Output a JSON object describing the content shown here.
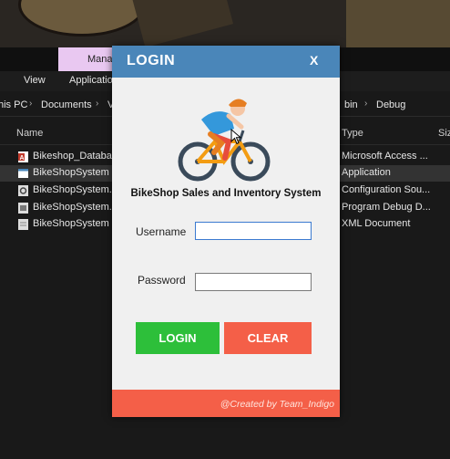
{
  "explorer": {
    "ribbon": {
      "manage_tab": "Mana"
    },
    "menu": {
      "view": "View",
      "application": "Applicatio"
    },
    "address": {
      "this_pc": "his PC",
      "documents": "Documents",
      "partial": "V",
      "bin": "bin",
      "debug": "Debug"
    },
    "columns": {
      "name": "Name",
      "type": "Type",
      "size": "Siz"
    },
    "files": [
      {
        "name": "Bikeshop_Database",
        "type": "Microsoft Access ...",
        "icon": "access-file-icon",
        "color": "#c0392b"
      },
      {
        "name": "BikeShopSystem",
        "type": "Application",
        "icon": "application-icon",
        "color": "#ffffff"
      },
      {
        "name": "BikeShopSystem.ex",
        "type": "Configuration Sou...",
        "icon": "config-file-icon",
        "color": "#dddddd"
      },
      {
        "name": "BikeShopSystem.p",
        "type": "Program Debug D...",
        "icon": "debug-file-icon",
        "color": "#dddddd"
      },
      {
        "name": "BikeShopSystem",
        "type": "XML Document",
        "icon": "xml-file-icon",
        "color": "#dddddd"
      }
    ]
  },
  "login": {
    "title": "LOGIN",
    "close": "X",
    "app_title": "BikeShop Sales and Inventory System",
    "username_label": "Username",
    "password_label": "Password",
    "username_value": "",
    "password_value": "",
    "login_button": "LOGIN",
    "clear_button": "CLEAR",
    "footer": "@Created by Team_Indigo",
    "colors": {
      "header": "#4a86b9",
      "login": "#2dbf3a",
      "clear": "#f45f48",
      "footer": "#f45f48"
    }
  }
}
